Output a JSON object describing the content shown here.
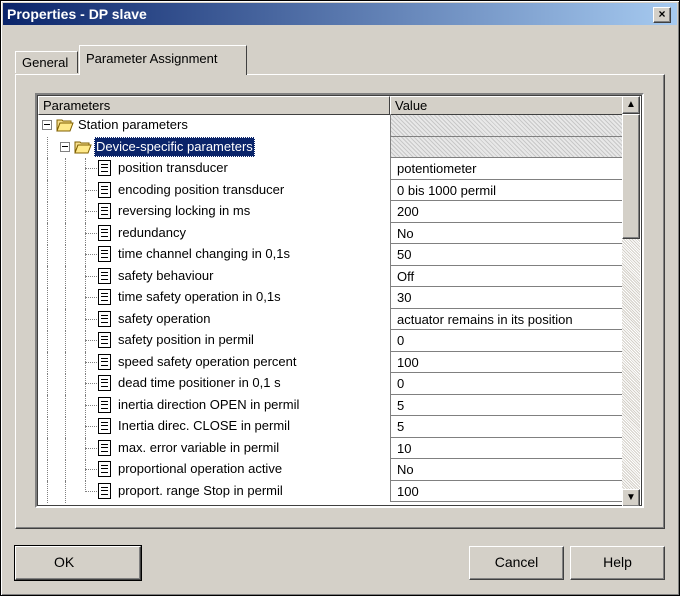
{
  "window": {
    "title": "Properties - DP slave",
    "close_glyph": "×"
  },
  "tabs": [
    {
      "label": "General"
    },
    {
      "label": "Parameter Assignment"
    }
  ],
  "list": {
    "col_params": "Parameters",
    "col_value": "Value",
    "root": {
      "label": "Station parameters"
    },
    "group": {
      "label": "Device-specific parameters"
    },
    "items": [
      {
        "label": "position transducer",
        "value": "potentiometer"
      },
      {
        "label": "encoding position transducer",
        "value": "0 bis 1000 permil"
      },
      {
        "label": "reversing locking in ms",
        "value": "200"
      },
      {
        "label": "redundancy",
        "value": "No"
      },
      {
        "label": "time channel changing in 0,1s",
        "value": "50"
      },
      {
        "label": "safety behaviour",
        "value": "Off"
      },
      {
        "label": "time safety operation in 0,1s",
        "value": "30"
      },
      {
        "label": "safety operation",
        "value": "actuator remains in its position"
      },
      {
        "label": "safety position in permil",
        "value": "0"
      },
      {
        "label": "speed safety operation percent",
        "value": "100"
      },
      {
        "label": "dead time positioner in 0,1 s",
        "value": "0"
      },
      {
        "label": "inertia direction OPEN in permil",
        "value": "5"
      },
      {
        "label": "Inertia direc. CLOSE in permil",
        "value": "5"
      },
      {
        "label": "max. error variable in permil",
        "value": "10"
      },
      {
        "label": "proportional operation active",
        "value": "No"
      },
      {
        "label": "proport. range Stop in permil",
        "value": "100"
      }
    ]
  },
  "scroll": {
    "up_glyph": "▲",
    "down_glyph": "▼"
  },
  "buttons": {
    "ok": "OK",
    "cancel": "Cancel",
    "help": "Help"
  }
}
